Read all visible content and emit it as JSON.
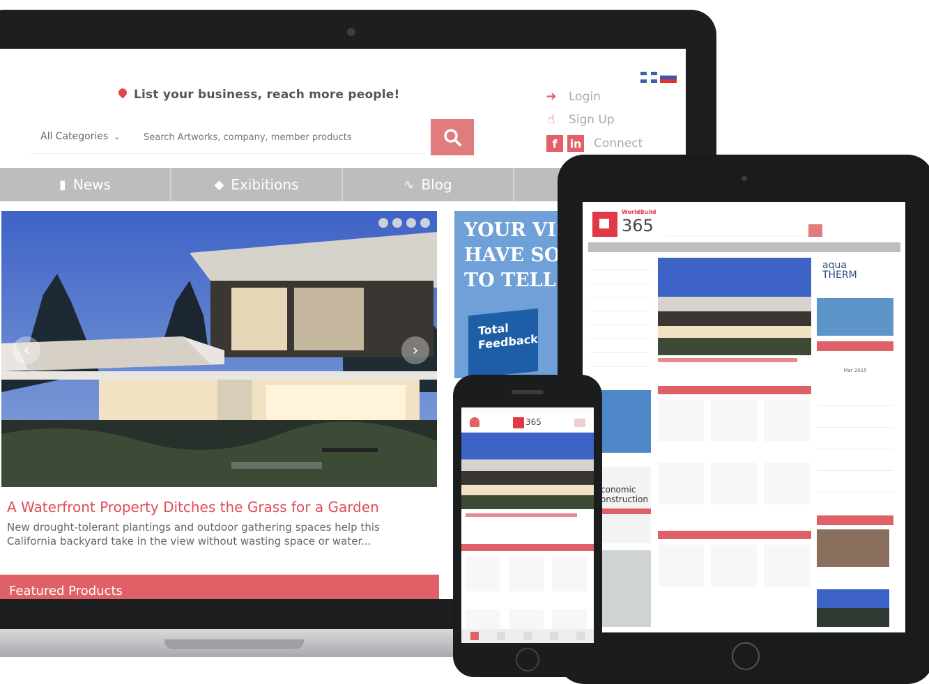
{
  "laptop": {
    "slogan": "List your business, reach more people!",
    "search": {
      "category": "All Categories",
      "placeholder": "Search Artworks, company, member products",
      "button_icon": "search-icon"
    },
    "account": {
      "login": "Login",
      "signup": "Sign Up",
      "connect": "Connect",
      "facebook": "f",
      "linkedin": "in"
    },
    "nav": [
      {
        "label": "News",
        "icon": "newspaper-icon"
      },
      {
        "label": "Exibitions",
        "icon": "tag-icon"
      },
      {
        "label": "Blog",
        "icon": "rss-icon"
      },
      {
        "label": "",
        "icon": "user-icon"
      }
    ],
    "hero": {
      "headline": "A Waterfront Property Ditches the Grass for a Garden",
      "description": "New drought-tolerant plantings and outdoor gathering spaces help this California backyard take in the view without wasting space or water..."
    },
    "featured_label": "Featured Products",
    "ad": {
      "line1": "YOUR VIS",
      "line2": "HAVE SO",
      "line3": "TO TELL",
      "box": "Total Feedback"
    }
  },
  "tablet": {
    "logo_number": "365",
    "logo_name": "WorldBuild",
    "side_ad_line1": "aqua",
    "side_ad_line2": "THERM",
    "date_readout": "Mar 2015",
    "magazine": "conomic onstruction"
  },
  "phone": {
    "logo_number": "365"
  },
  "colors": {
    "accent": "#e06067",
    "nav_gray": "#bdbdbd",
    "search_button": "#e07b7e"
  }
}
